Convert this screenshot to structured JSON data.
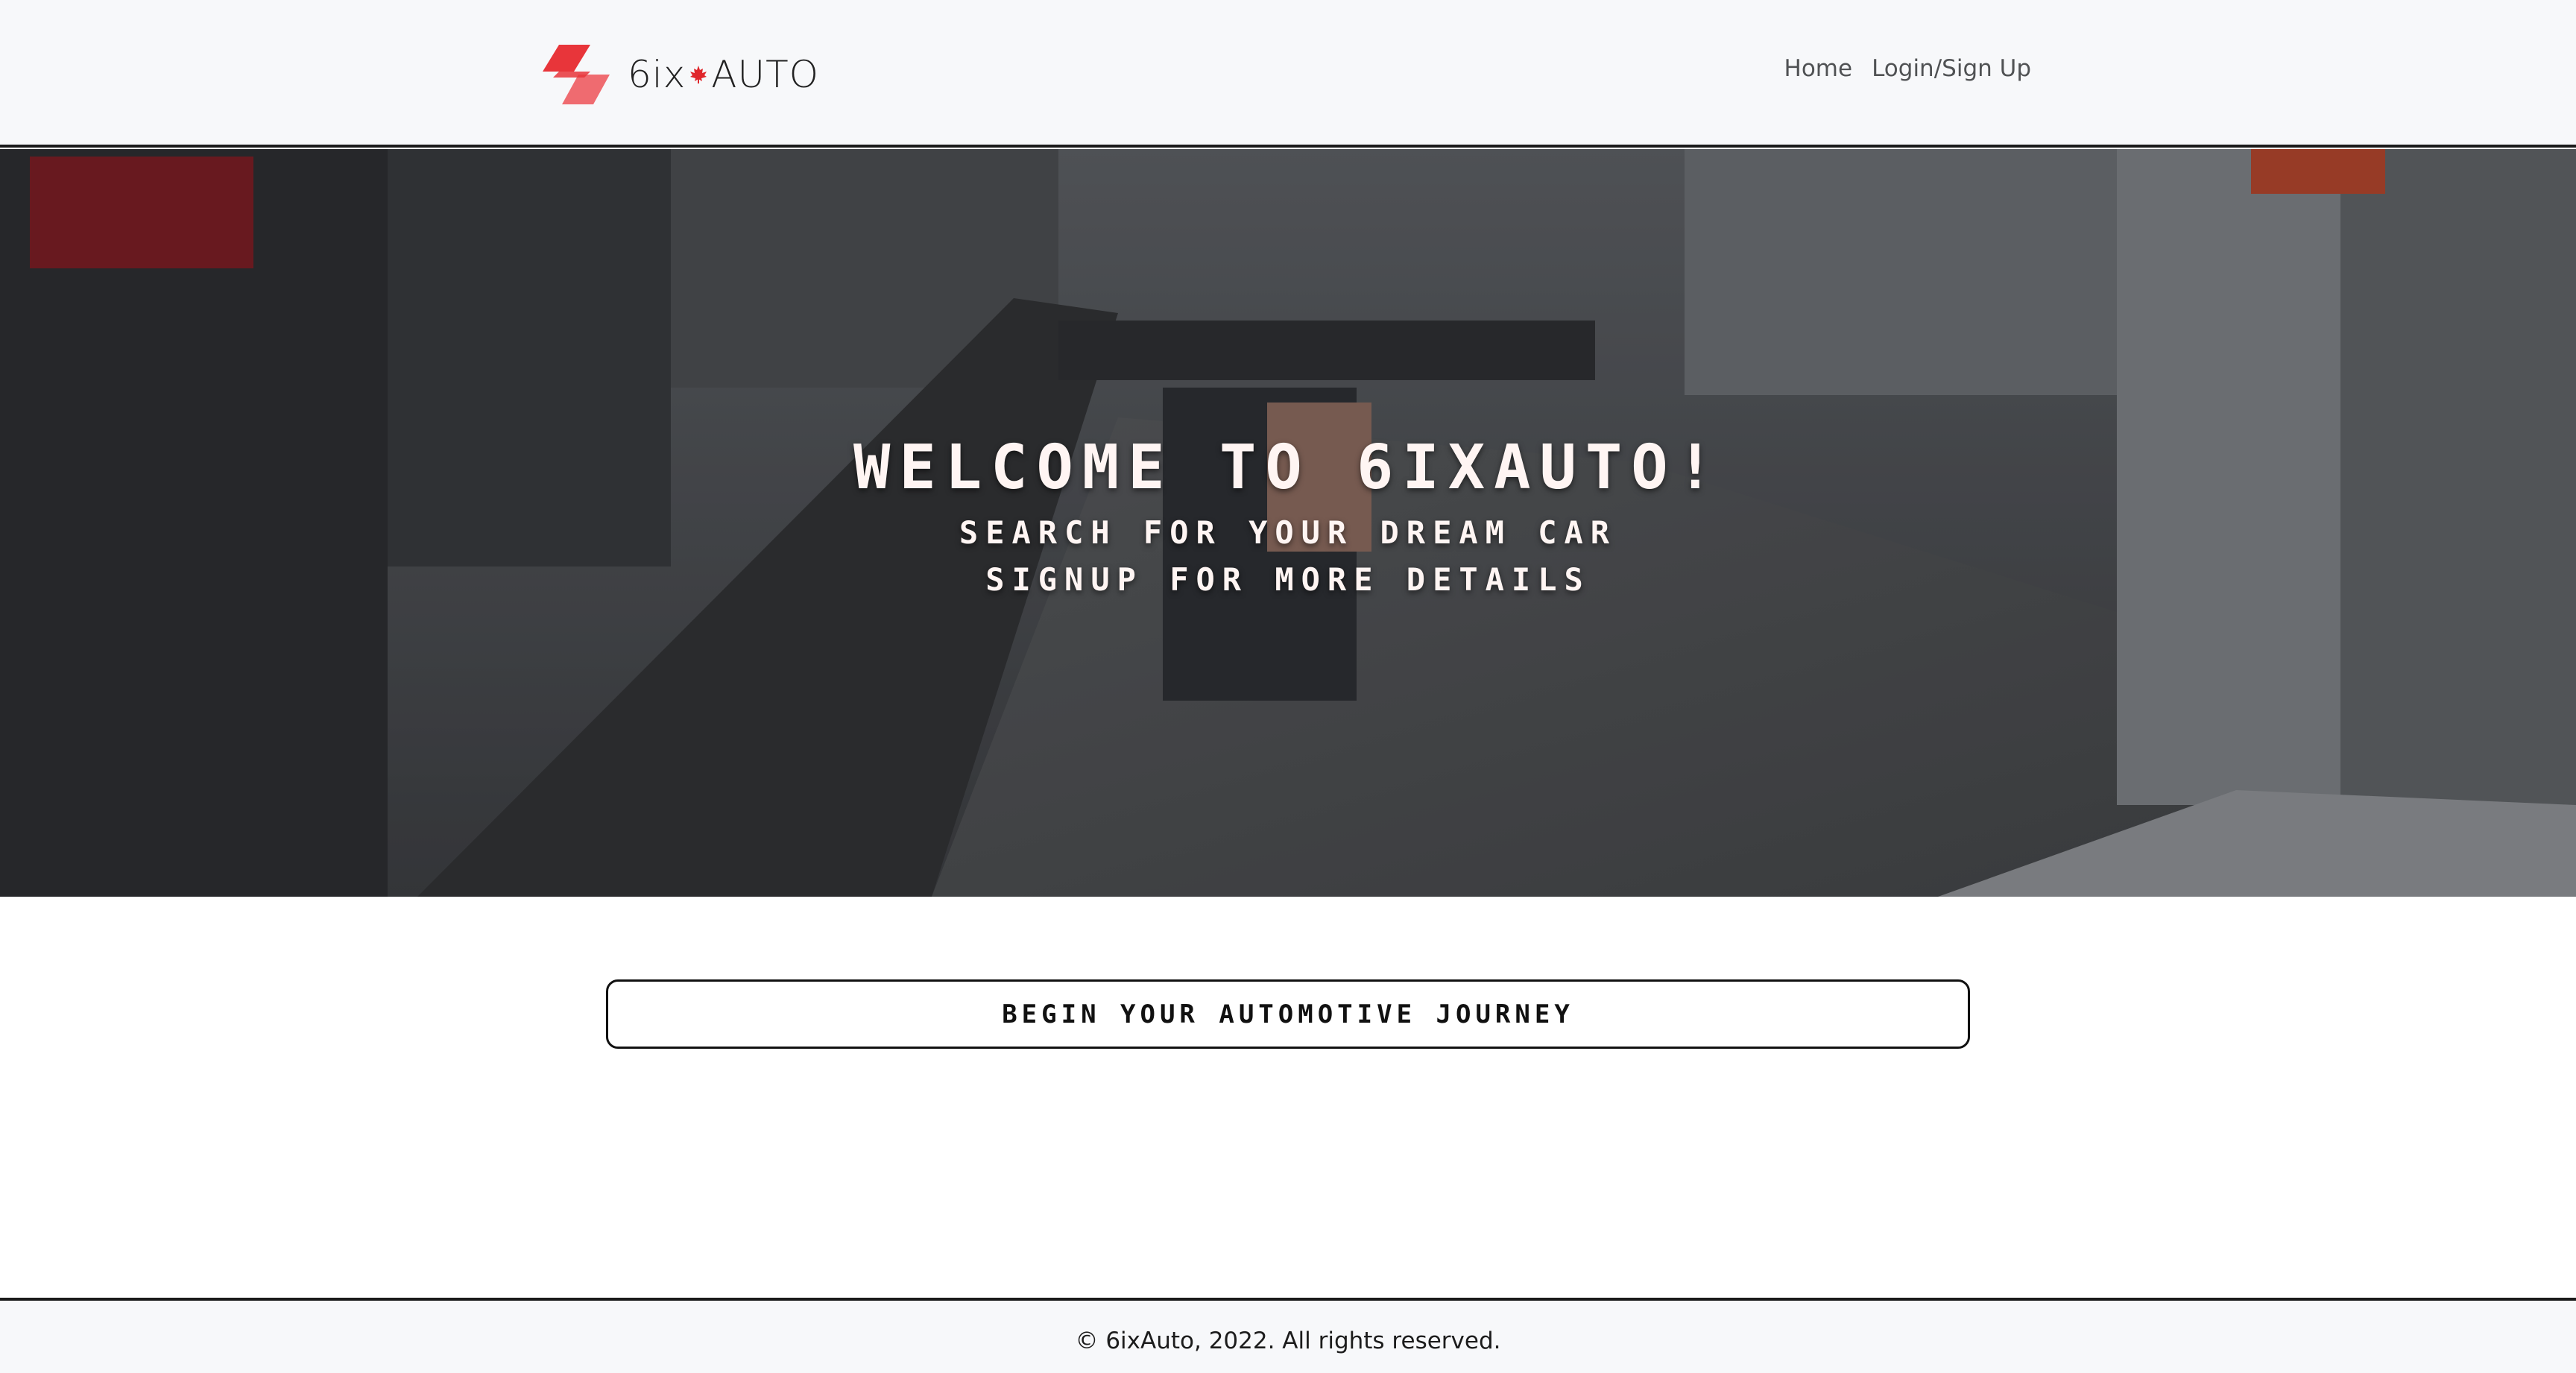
{
  "navbar": {
    "brand": {
      "prefix": "6ix",
      "suffix": "AUTO",
      "logo_colors": [
        "#e8353a",
        "#ef6b70"
      ],
      "leaf_color": "#e0262b"
    },
    "links": [
      {
        "label": "Home"
      },
      {
        "label": "Login/Sign Up"
      }
    ]
  },
  "hero": {
    "title": "WELCOME TO 6IXAUTO!",
    "subtitle_1": "SEARCH FOR YOUR DREAM CAR",
    "subtitle_2": "SIGNUP FOR MORE DETAILS",
    "background_icon": "city-street-scene"
  },
  "cta": {
    "label": "BEGIN YOUR AUTOMOTIVE JOURNEY"
  },
  "footer": {
    "copyright": "© 6ixAuto, 2022. All rights reserved."
  }
}
